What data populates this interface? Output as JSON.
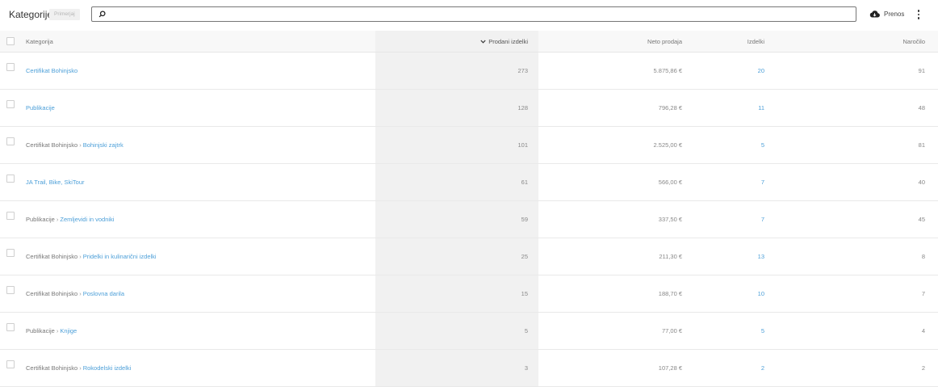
{
  "header": {
    "title": "Kategorije",
    "compare_label": "Primerjaj",
    "search_placeholder": "",
    "export_label": "Prenos"
  },
  "table": {
    "columns": {
      "category": "Kategorija",
      "sold": "Prodani izdelki",
      "net": "Neto prodaja",
      "products": "Izdelki",
      "orders": "Naročilo"
    },
    "rows": [
      {
        "parent": "",
        "name": "Certifikat Bohinjsko",
        "sold": "273",
        "net": "5.875,86 €",
        "products": "20",
        "orders": "91"
      },
      {
        "parent": "",
        "name": "Publikacije",
        "sold": "128",
        "net": "796,28 €",
        "products": "11",
        "orders": "48"
      },
      {
        "parent": "Certifikat Bohinjsko",
        "name": "Bohinjski zajtrk",
        "sold": "101",
        "net": "2.525,00 €",
        "products": "5",
        "orders": "81"
      },
      {
        "parent": "",
        "name": "JA Trail, Bike, SkiTour",
        "sold": "61",
        "net": "566,00 €",
        "products": "7",
        "orders": "40"
      },
      {
        "parent": "Publikacije",
        "name": "Zemljevidi in vodniki",
        "sold": "59",
        "net": "337,50 €",
        "products": "7",
        "orders": "45"
      },
      {
        "parent": "Certifikat Bohinjsko",
        "name": "Pridelki in kulinarični izdelki",
        "sold": "25",
        "net": "211,30 €",
        "products": "13",
        "orders": "8"
      },
      {
        "parent": "Certifikat Bohinjsko",
        "name": "Poslovna darila",
        "sold": "15",
        "net": "188,70 €",
        "products": "10",
        "orders": "7"
      },
      {
        "parent": "Publikacije",
        "name": "Knjige",
        "sold": "5",
        "net": "77,00 €",
        "products": "5",
        "orders": "4"
      },
      {
        "parent": "Certifikat Bohinjsko",
        "name": "Rokodelski izdelki",
        "sold": "3",
        "net": "107,28 €",
        "products": "2",
        "orders": "2"
      }
    ]
  },
  "colors": {
    "link": "#4c9fd8",
    "sorted_column_bg": "#f1f1f1"
  }
}
